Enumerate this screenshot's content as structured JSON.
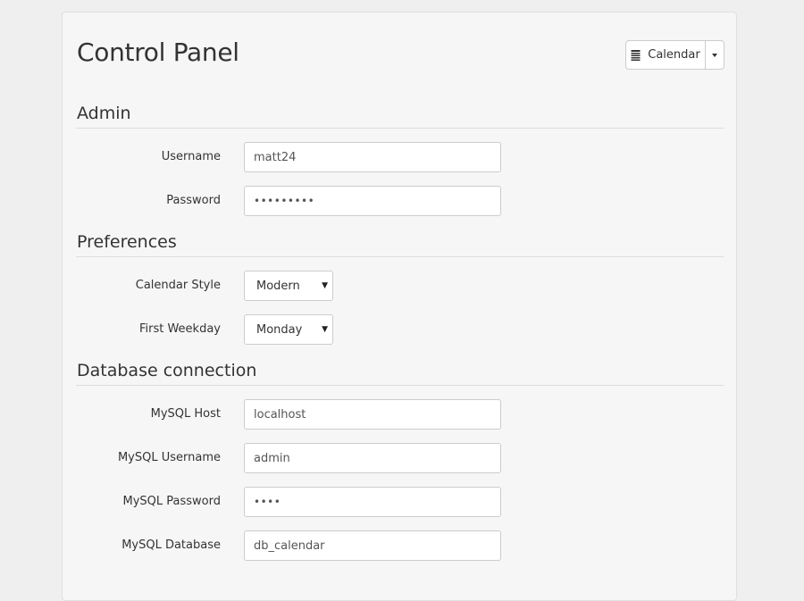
{
  "header": {
    "title": "Control Panel",
    "calendar_button": "Calendar"
  },
  "sections": {
    "admin": {
      "title": "Admin",
      "username_label": "Username",
      "username_value": "matt24",
      "password_label": "Password",
      "password_value": "•••••••••"
    },
    "preferences": {
      "title": "Preferences",
      "calendar_style_label": "Calendar Style",
      "calendar_style_value": "Modern",
      "first_weekday_label": "First Weekday",
      "first_weekday_value": "Monday"
    },
    "database": {
      "title": "Database connection",
      "host_label": "MySQL Host",
      "host_value": "localhost",
      "username_label": "MySQL Username",
      "username_value": "admin",
      "password_label": "MySQL Password",
      "password_value": "••••",
      "database_label": "MySQL Database",
      "database_value": "db_calendar"
    }
  },
  "icons": {
    "calendar": "calendar-icon",
    "caret": "caret-down-icon",
    "select_arrow": "select-arrow-icon"
  }
}
